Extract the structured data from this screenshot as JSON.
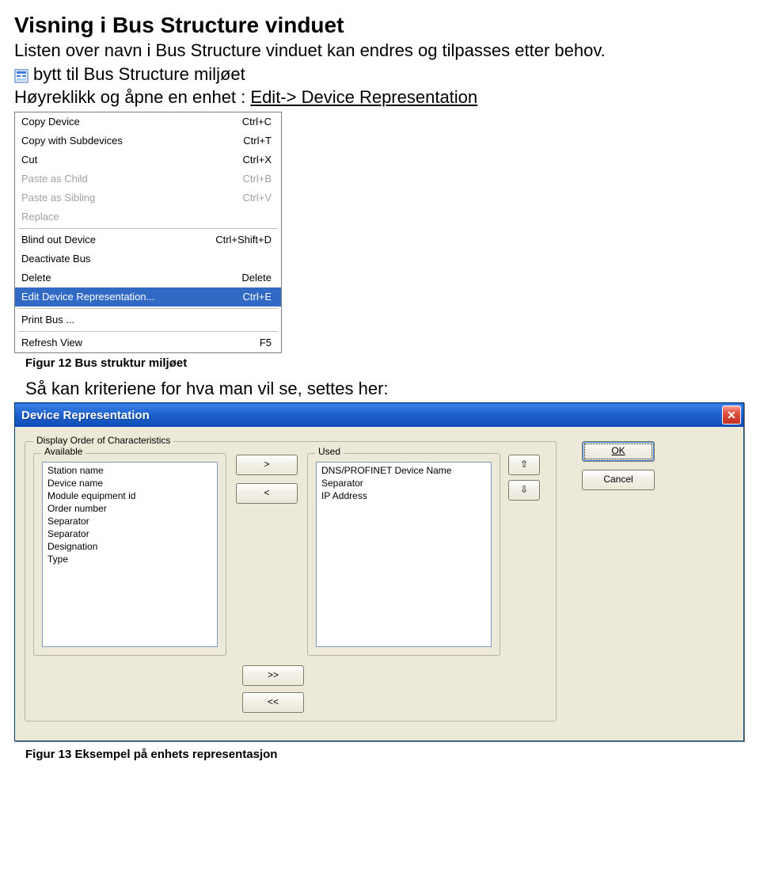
{
  "doc": {
    "heading": "Visning i Bus Structure vinduet",
    "para1": "Listen over navn i Bus Structure vinduet kan endres og tilpasses etter behov.",
    "icon_line": "bytt til Bus Structure miljøet",
    "para2a": "Høyreklikk og åpne en enhet : ",
    "para2b": "Edit-> Device Representation",
    "caption12": "Figur 12 Bus struktur miljøet",
    "para3": "Så kan kriteriene for hva man vil se, settes her:",
    "caption13": "Figur 13 Eksempel på enhets representasjon"
  },
  "menu": {
    "items": [
      {
        "label": "Copy Device",
        "shortcut": "Ctrl+C",
        "disabled": false
      },
      {
        "label": "Copy with Subdevices",
        "shortcut": "Ctrl+T",
        "disabled": false
      },
      {
        "label": "Cut",
        "shortcut": "Ctrl+X",
        "disabled": false
      },
      {
        "label": "Paste as Child",
        "shortcut": "Ctrl+B",
        "disabled": true
      },
      {
        "label": "Paste as Sibling",
        "shortcut": "Ctrl+V",
        "disabled": true
      },
      {
        "label": "Replace",
        "shortcut": "",
        "disabled": true
      }
    ],
    "items2": [
      {
        "label": "Blind out Device",
        "shortcut": "Ctrl+Shift+D",
        "disabled": false
      },
      {
        "label": "Deactivate Bus",
        "shortcut": "",
        "disabled": false
      },
      {
        "label": "Delete",
        "shortcut": "Delete",
        "disabled": false
      },
      {
        "label": "Edit Device Representation...",
        "shortcut": "Ctrl+E",
        "disabled": false,
        "selected": true
      }
    ],
    "items3": [
      {
        "label": "Print Bus ...",
        "shortcut": "",
        "disabled": false
      }
    ],
    "items4": [
      {
        "label": "Refresh View",
        "shortcut": "F5",
        "disabled": false
      }
    ]
  },
  "dialog": {
    "title": "Device Representation",
    "group_label": "Display Order of Characteristics",
    "available_label": "Available",
    "used_label": "Used",
    "available": [
      "Station name",
      "Device name",
      "Module equipment id",
      "Order number",
      "Separator",
      "Separator",
      "Designation",
      "Type"
    ],
    "used": [
      "DNS/PROFINET Device Name",
      "Separator",
      "IP Address"
    ],
    "btn_right": ">",
    "btn_left": "<",
    "btn_up": "⇧",
    "btn_down": "⇩",
    "btn_ok": "OK",
    "btn_cancel": "Cancel",
    "btn_all_right": ">>",
    "btn_all_left": "<<"
  }
}
